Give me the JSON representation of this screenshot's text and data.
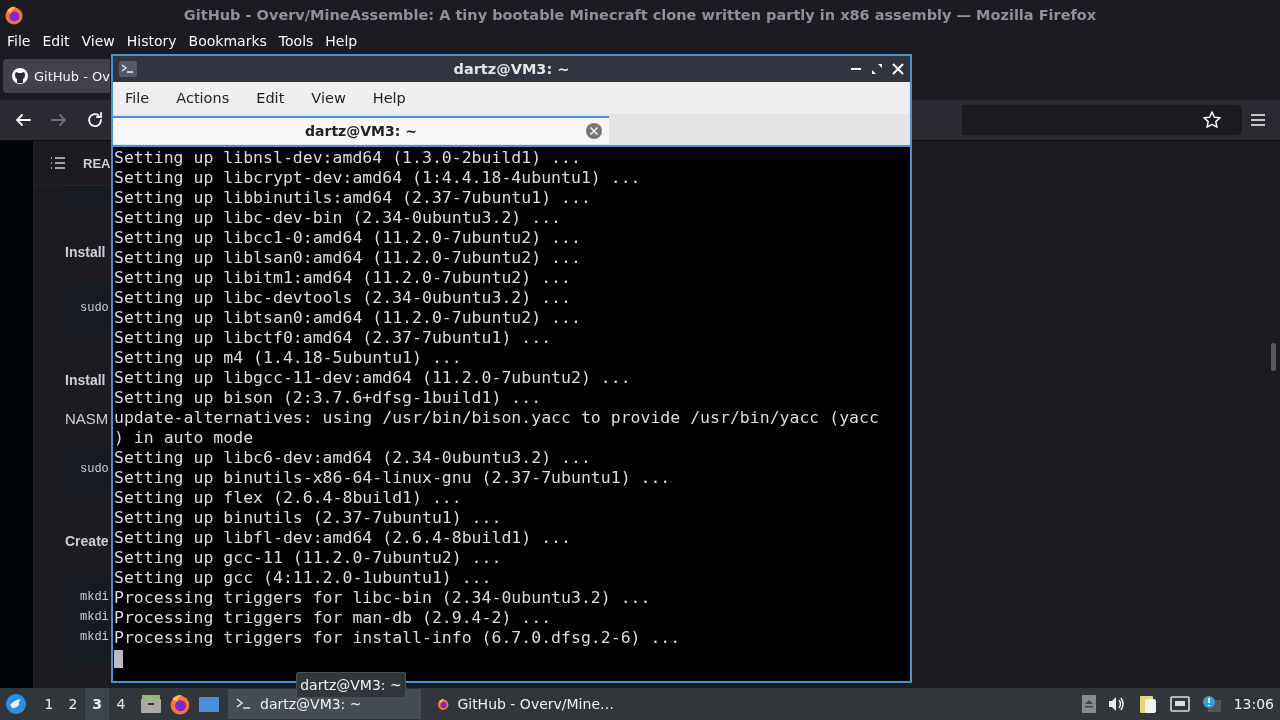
{
  "browser": {
    "title": "GitHub - Overv/MineAssemble: A tiny bootable Minecraft clone written partly in x86 assembly — Mozilla Firefox",
    "menu": [
      "File",
      "Edit",
      "View",
      "History",
      "Bookmarks",
      "Tools",
      "Help"
    ],
    "tab": {
      "label": "GitHub - Ov"
    },
    "nav": [
      {
        "kind": "back",
        "disabled": false
      },
      {
        "kind": "forward",
        "disabled": true
      },
      {
        "kind": "reload",
        "disabled": false
      }
    ],
    "readme": {
      "header": "REA",
      "blocks": [
        {
          "kind": "code",
          "lines": [
            "sudo"
          ]
        },
        {
          "kind": "heading",
          "text": "Install"
        },
        {
          "kind": "text",
          "text": "NASM"
        },
        {
          "kind": "code",
          "lines": [
            "sudo"
          ]
        },
        {
          "kind": "heading",
          "text": "Create"
        },
        {
          "kind": "code",
          "lines": [
            "mkdi",
            "mkdi",
            "mkdi"
          ]
        }
      ],
      "first_heading": "Install"
    }
  },
  "terminal": {
    "title": "dartz@VM3: ~",
    "menu": [
      "File",
      "Actions",
      "Edit",
      "View",
      "Help"
    ],
    "tab": {
      "label": "dartz@VM3: ~",
      "selected": true
    },
    "lines": [
      "Setting up libnsl-dev:amd64 (1.3.0-2build1) ...",
      "Setting up libcrypt-dev:amd64 (1:4.4.18-4ubuntu1) ...",
      "Setting up libbinutils:amd64 (2.37-7ubuntu1) ...",
      "Setting up libc-dev-bin (2.34-0ubuntu3.2) ...",
      "Setting up libcc1-0:amd64 (11.2.0-7ubuntu2) ...",
      "Setting up liblsan0:amd64 (11.2.0-7ubuntu2) ...",
      "Setting up libitm1:amd64 (11.2.0-7ubuntu2) ...",
      "Setting up libc-devtools (2.34-0ubuntu3.2) ...",
      "Setting up libtsan0:amd64 (11.2.0-7ubuntu2) ...",
      "Setting up libctf0:amd64 (2.37-7ubuntu1) ...",
      "Setting up m4 (1.4.18-5ubuntu1) ...",
      "Setting up libgcc-11-dev:amd64 (11.2.0-7ubuntu2) ...",
      "Setting up bison (2:3.7.6+dfsg-1build1) ...",
      "update-alternatives: using /usr/bin/bison.yacc to provide /usr/bin/yacc (yacc",
      ") in auto mode",
      "Setting up libc6-dev:amd64 (2.34-0ubuntu3.2) ...",
      "Setting up binutils-x86-64-linux-gnu (2.37-7ubuntu1) ...",
      "Setting up flex (2.6.4-8build1) ...",
      "Setting up binutils (2.37-7ubuntu1) ...",
      "Setting up libfl-dev:amd64 (2.6.4-8build1) ...",
      "Setting up gcc-11 (11.2.0-7ubuntu2) ...",
      "Setting up gcc (4:11.2.0-1ubuntu1) ...",
      "Processing triggers for libc-bin (2.34-0ubuntu3.2) ...",
      "Processing triggers for man-db (2.9.4-2) ...",
      "Processing triggers for install-info (6.7.0.dfsg.2-6) ..."
    ]
  },
  "taskbar": {
    "desktops": [
      {
        "label": "1",
        "selected": false
      },
      {
        "label": "2",
        "selected": false
      },
      {
        "label": "3",
        "selected": true
      },
      {
        "label": "4",
        "selected": false
      }
    ],
    "tasks": [
      {
        "kind": "terminal",
        "label": "dartz@VM3: ~",
        "selected": true
      },
      {
        "kind": "firefox",
        "label": "GitHub - Overv/Mine…",
        "selected": false
      }
    ],
    "clock": "13:06",
    "tooltip": "dartz@VM3: ~"
  }
}
